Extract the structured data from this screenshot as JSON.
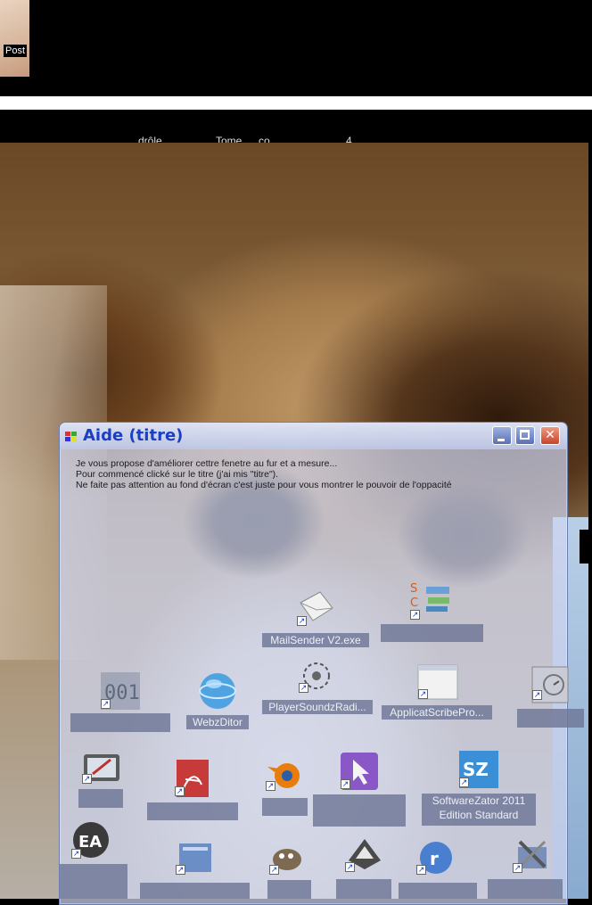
{
  "thumbnail": {
    "label": "Post"
  },
  "top_labels": [
    "drôle",
    "Tome",
    "co",
    "4"
  ],
  "window": {
    "title": "Aide (titre)",
    "buttons": {
      "minimize": "",
      "maximize": "",
      "close": "✕"
    },
    "text_lines": [
      "Je vous propose d'améliorer cettre fenetre au fur et a mesure...",
      "Pour commencé clické sur le titre (j'ai mis \"titre\").",
      "Ne faite pas attention au fond d'écran c'est juste pour vous montrer le pouvoir de l'oppacité"
    ]
  },
  "desktop_icons": [
    {
      "label": "MailSender V2.exe",
      "icon": "envelope-icon"
    },
    {
      "label": "",
      "icon": "scribe-icon"
    },
    {
      "label": "",
      "icon": "d01-icon"
    },
    {
      "label": "WebzDitor",
      "icon": "globe-icon"
    },
    {
      "label": "PlayerSoundzRadi...",
      "icon": "radio-icon"
    },
    {
      "label": "ApplicatScribePro...",
      "icon": "window-icon"
    },
    {
      "label": "",
      "icon": "clock-icon"
    },
    {
      "label": "",
      "icon": "tablet-icon"
    },
    {
      "label": "",
      "icon": "pdf-icon"
    },
    {
      "label": "",
      "icon": "blender-icon"
    },
    {
      "label": "",
      "icon": "cursor-icon"
    },
    {
      "label": "SoftwareZator 2011\nEdition Standard",
      "icon": "sz-icon"
    },
    {
      "label": "",
      "icon": "ea-icon"
    },
    {
      "label": "",
      "icon": "folder-icon"
    },
    {
      "label": "",
      "icon": "gimp-icon"
    },
    {
      "label": "",
      "icon": "ink-icon"
    },
    {
      "label": "",
      "icon": "real-icon"
    },
    {
      "label": "",
      "icon": "tools-icon"
    }
  ],
  "colors": {
    "title": "#1a3fc4",
    "close": "#c8442a"
  }
}
